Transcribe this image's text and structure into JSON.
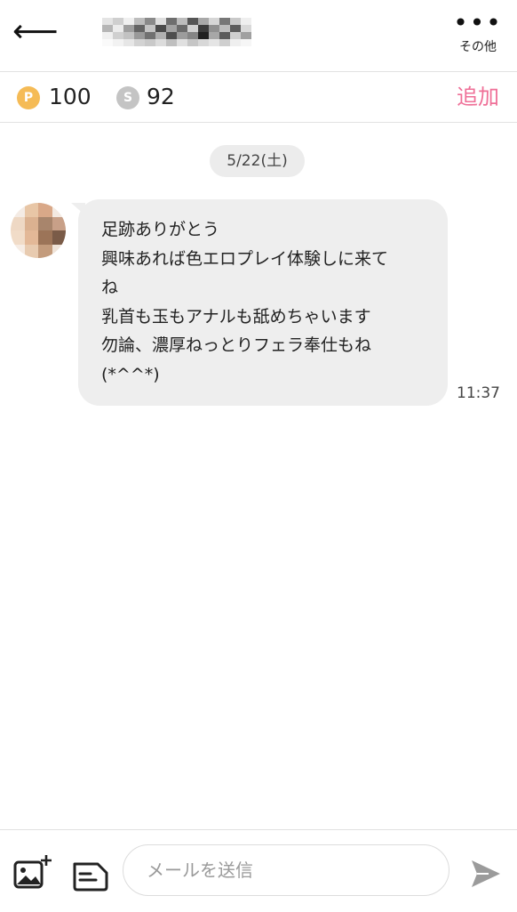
{
  "header": {
    "back_icon": "back-arrow-icon",
    "more_icon": "more-dots-icon",
    "more_label": "その他"
  },
  "points": {
    "p_badge": "P",
    "p_value": "100",
    "s_badge": "S",
    "s_value": "92",
    "add_label": "追加",
    "accent_color": "#ef6f97"
  },
  "chat": {
    "date": "5/22(土)",
    "message": {
      "lines": [
        "足跡ありがとう",
        "興味あれば色エロプレイ体験しに来て",
        "ね",
        "乳首も玉もアナルも舐めちゃいます",
        "勿論、濃厚ねっとりフェラ奉仕もね",
        "(*^^*)"
      ],
      "time": "11:37"
    }
  },
  "footer": {
    "image_icon": "add-image-icon",
    "template_icon": "template-card-icon",
    "input_placeholder": "メールを送信",
    "send_icon": "send-icon"
  }
}
